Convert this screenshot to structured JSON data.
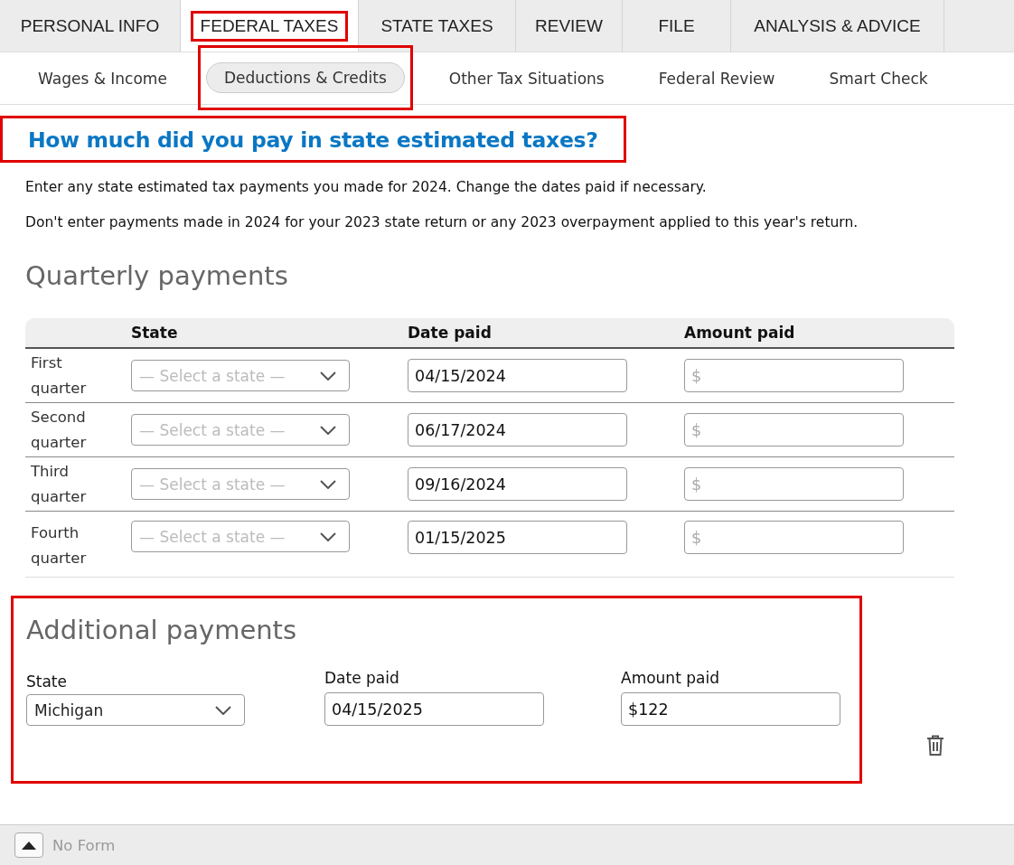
{
  "tabs": [
    {
      "label": "PERSONAL INFO",
      "selected": false,
      "highlighted": false
    },
    {
      "label": "FEDERAL TAXES",
      "selected": true,
      "highlighted": true
    },
    {
      "label": "STATE TAXES",
      "selected": false,
      "highlighted": false
    },
    {
      "label": "REVIEW",
      "selected": false,
      "highlighted": false
    },
    {
      "label": "FILE",
      "selected": false,
      "highlighted": false
    },
    {
      "label": "ANALYSIS & ADVICE",
      "selected": false,
      "highlighted": false
    }
  ],
  "subtabs": [
    {
      "label": "Wages & Income",
      "selected": false,
      "highlighted": false
    },
    {
      "label": "Deductions & Credits",
      "selected": true,
      "highlighted": true
    },
    {
      "label": "Other Tax Situations",
      "selected": false,
      "highlighted": false
    },
    {
      "label": "Federal Review",
      "selected": false,
      "highlighted": false
    },
    {
      "label": "Smart Check",
      "selected": false,
      "highlighted": false
    }
  ],
  "heading": {
    "text": "How much did you pay in state estimated taxes?",
    "highlighted": true
  },
  "paragraphs": [
    "Enter any state estimated tax payments you made for 2024. Change the dates paid if necessary.",
    "Don't enter payments made in 2024 for your 2023 state return or any 2023 overpayment applied to this year's return."
  ],
  "quarterly": {
    "title": "Quarterly payments",
    "columns": [
      "State",
      "Date paid",
      "Amount paid"
    ],
    "rows": [
      {
        "label": "First quarter",
        "state_placeholder": "— Select a state —",
        "date": "04/15/2024",
        "amount_placeholder": "$"
      },
      {
        "label": "Second quarter",
        "state_placeholder": "— Select a state —",
        "date": "06/17/2024",
        "amount_placeholder": "$"
      },
      {
        "label": "Third quarter",
        "state_placeholder": "— Select a state —",
        "date": "09/16/2024",
        "amount_placeholder": "$"
      },
      {
        "label": "Fourth quarter",
        "state_placeholder": "— Select a state —",
        "date": "01/15/2025",
        "amount_placeholder": "$"
      }
    ]
  },
  "additional": {
    "title": "Additional payments",
    "highlighted": true,
    "state_label": "State",
    "state": "Michigan",
    "date_label": "Date paid",
    "date": "04/15/2025",
    "amount_label": "Amount paid",
    "amount": "$122"
  },
  "footer": {
    "label": "No Form"
  }
}
